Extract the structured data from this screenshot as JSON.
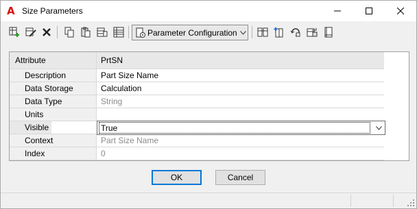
{
  "window": {
    "title": "Size Parameters",
    "app_icon": "autodesk-a-icon",
    "app_letter": "A"
  },
  "toolbar": {
    "icons_left": [
      "add-parameter-icon",
      "edit-parameter-icon",
      "delete-icon",
      "copy-icon",
      "paste-icon",
      "parameter-list-icon",
      "table-icon"
    ],
    "param_config_label": "Parameter Configuration",
    "icons_right": [
      "parameter-tree-icon",
      "add-column-icon",
      "refresh-icon",
      "export-icon",
      "book-icon"
    ]
  },
  "grid": {
    "header": {
      "attribute": "Attribute",
      "value": "PrtSN"
    },
    "rows": [
      {
        "name": "Description",
        "value": "Part Size Name",
        "greyed": false
      },
      {
        "name": "Data Storage",
        "value": "Calculation",
        "greyed": false
      },
      {
        "name": "Data Type",
        "value": "String",
        "greyed": true
      },
      {
        "name": "Units",
        "value": "",
        "greyed": true
      },
      {
        "name": "Visible",
        "value": "True",
        "greyed": false
      },
      {
        "name": "Context",
        "value": "Part Size Name",
        "greyed": true
      },
      {
        "name": "Index",
        "value": "0",
        "greyed": true
      }
    ]
  },
  "buttons": {
    "ok": "OK",
    "cancel": "Cancel"
  },
  "colors": {
    "accent": "#0078d7",
    "app_red": "#dd1111"
  }
}
